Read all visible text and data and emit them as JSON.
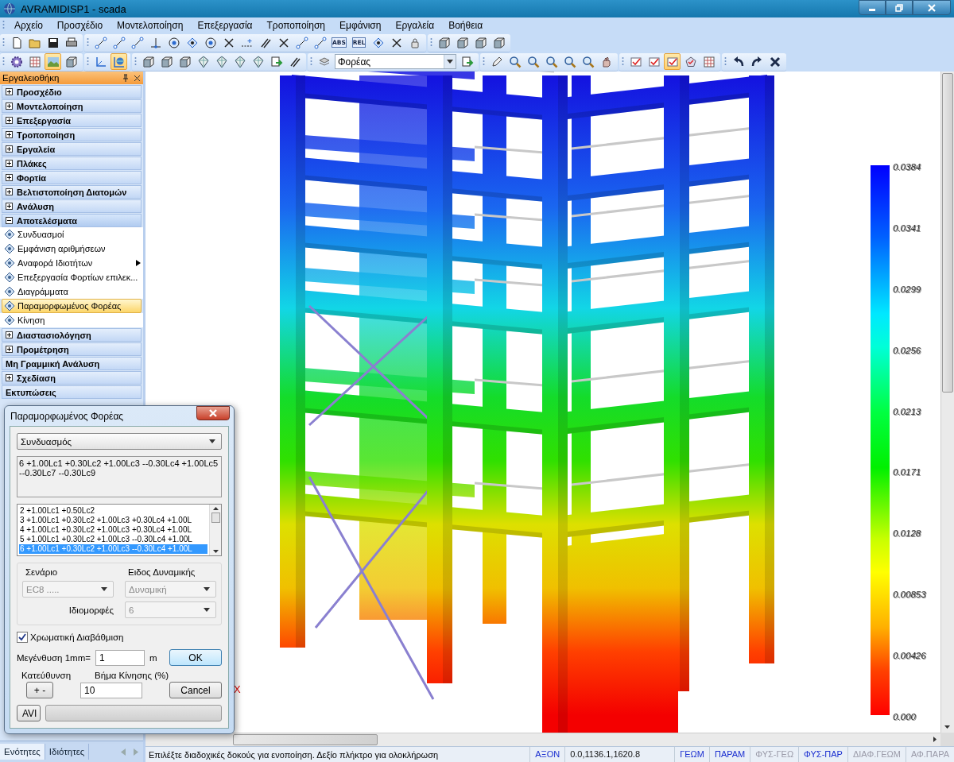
{
  "window": {
    "title": "AVRAMIDISP1 - scada"
  },
  "menu": [
    "Αρχείο",
    "Προσχέδιο",
    "Μοντελοποίηση",
    "Επεξεργασία",
    "Τροποποίηση",
    "Εμφάνιση",
    "Εργαλεία",
    "Βοήθεια"
  ],
  "toolbars": [
    {
      "groups": [
        {
          "items": [
            {
              "kind": "doc",
              "selected": false
            },
            {
              "kind": "folder",
              "selected": false
            },
            {
              "kind": "save",
              "selected": false
            },
            {
              "kind": "print",
              "selected": false
            }
          ]
        },
        {
          "items": [
            {
              "kind": "line",
              "selected": false
            },
            {
              "kind": "line",
              "selected": false
            },
            {
              "kind": "line",
              "selected": false
            },
            {
              "kind": "perp",
              "selected": false
            },
            {
              "kind": "circle",
              "selected": false
            },
            {
              "kind": "node",
              "selected": false
            },
            {
              "kind": "circle",
              "selected": false
            },
            {
              "kind": "cross",
              "selected": false
            },
            {
              "kind": "dash",
              "selected": false
            },
            {
              "kind": "parallel",
              "selected": false
            },
            {
              "kind": "cross",
              "selected": false
            },
            {
              "kind": "line",
              "selected": false
            },
            {
              "kind": "line",
              "selected": false
            },
            {
              "kind": "text",
              "label": "ABS",
              "selected": false
            },
            {
              "kind": "text",
              "label": "REL",
              "selected": false
            },
            {
              "kind": "node",
              "selected": false
            },
            {
              "kind": "cross",
              "selected": false
            },
            {
              "kind": "lock",
              "selected": false
            }
          ]
        },
        {
          "items": [
            {
              "kind": "cube",
              "selected": false
            },
            {
              "kind": "cube",
              "selected": false
            },
            {
              "kind": "cube",
              "selected": false
            },
            {
              "kind": "cube",
              "selected": false
            }
          ]
        }
      ]
    },
    {
      "groups": [
        {
          "items": [
            {
              "kind": "gear",
              "selected": false
            },
            {
              "kind": "grid",
              "selected": false
            },
            {
              "kind": "image",
              "selected": true
            },
            {
              "kind": "cube",
              "selected": false
            }
          ]
        },
        {
          "items": [
            {
              "kind": "axes",
              "selected": false
            },
            {
              "kind": "globe",
              "selected": true
            }
          ]
        },
        {
          "items": [
            {
              "kind": "cube",
              "selected": false
            },
            {
              "kind": "cube",
              "selected": false
            },
            {
              "kind": "cube",
              "selected": false
            },
            {
              "kind": "diamond",
              "selected": false
            },
            {
              "kind": "diamond",
              "selected": false
            },
            {
              "kind": "diamond",
              "selected": false
            },
            {
              "kind": "diamond",
              "selected": false
            },
            {
              "kind": "export",
              "selected": false
            },
            {
              "kind": "parallel",
              "selected": false
            }
          ]
        },
        {
          "items": [
            {
              "kind": "layers",
              "selected": false
            },
            {
              "kind": "combo",
              "value": "Φορέας"
            },
            {
              "kind": "export",
              "selected": false
            }
          ]
        },
        {
          "items": [
            {
              "kind": "pencil",
              "selected": false
            },
            {
              "kind": "zoom",
              "selected": false
            },
            {
              "kind": "zoom",
              "selected": false
            },
            {
              "kind": "zoom",
              "selected": false
            },
            {
              "kind": "zoom",
              "selected": false
            },
            {
              "kind": "zoom",
              "selected": false
            },
            {
              "kind": "hand",
              "selected": false
            }
          ]
        },
        {
          "items": [
            {
              "kind": "check",
              "selected": false
            },
            {
              "kind": "check",
              "selected": false
            },
            {
              "kind": "check",
              "selected": true
            },
            {
              "kind": "pentagon",
              "selected": false
            },
            {
              "kind": "grid",
              "selected": false
            }
          ]
        },
        {
          "items": [
            {
              "kind": "undo",
              "selected": false
            },
            {
              "kind": "redo",
              "selected": false
            },
            {
              "kind": "close",
              "selected": false
            }
          ]
        }
      ]
    }
  ],
  "toolbox": {
    "title": "Εργαλειοθήκη",
    "sections": [
      {
        "label": "Προσχέδιο",
        "expandable": true,
        "expanded": false
      },
      {
        "label": "Μοντελοποίηση",
        "expandable": true,
        "expanded": false
      },
      {
        "label": "Επεξεργασία",
        "expandable": true,
        "expanded": false
      },
      {
        "label": "Τροποποίηση",
        "expandable": true,
        "expanded": false
      },
      {
        "label": "Εργαλεία",
        "expandable": true,
        "expanded": false
      },
      {
        "label": "Πλάκες",
        "expandable": true,
        "expanded": false
      },
      {
        "label": "Φορτία",
        "expandable": true,
        "expanded": false
      },
      {
        "label": "Βελτιστοποίηση Διατομών",
        "expandable": true,
        "expanded": false
      },
      {
        "label": "Ανάλυση",
        "expandable": true,
        "expanded": false
      },
      {
        "label": "Αποτελέσματα",
        "expandable": true,
        "expanded": true,
        "children": [
          {
            "label": "Συνδυασμοί",
            "selected": false,
            "has_submenu": false
          },
          {
            "label": "Εμφάνιση αριθμήσεων",
            "selected": false,
            "has_submenu": false
          },
          {
            "label": "Αναφορά Ιδιοτήτων",
            "selected": false,
            "has_submenu": true
          },
          {
            "label": "Επεξεργασία Φορτίων επιλεκ...",
            "selected": false,
            "has_submenu": false
          },
          {
            "label": "Διαγράμματα",
            "selected": false,
            "has_submenu": false
          },
          {
            "label": "Παραμορφωμένος Φορέας",
            "selected": true,
            "has_submenu": false
          },
          {
            "label": "Κίνηση",
            "selected": false,
            "has_submenu": false
          }
        ]
      },
      {
        "label": "Διαστασιολόγηση",
        "expandable": true,
        "expanded": false
      },
      {
        "label": "Προμέτρηση",
        "expandable": true,
        "expanded": false
      },
      {
        "label": "Μη Γραμμική Ανάλυση",
        "expandable": false
      },
      {
        "label": "Σχεδίαση",
        "expandable": true,
        "expanded": false
      },
      {
        "label": "Εκτυπώσεις",
        "expandable": false
      }
    ]
  },
  "panel_tabs": [
    {
      "label": "Ενότητες",
      "selected": true
    },
    {
      "label": "Ιδιότητες",
      "selected": false
    }
  ],
  "viewport": {
    "axis_label": "X",
    "color_scale": {
      "labels": [
        "0.0384",
        "0.0341",
        "0.0299",
        "0.0256",
        "0.0213",
        "0.0171",
        "0.0128",
        "0.00853",
        "0.00426",
        "0.000"
      ]
    }
  },
  "dialog": {
    "title": "Παραμορφωμένος Φορέας",
    "type_select": {
      "value": "Συνδυασμός"
    },
    "combination_text": "6 +1.00Lc1 +0.30Lc2 +1.00Lc3 --0.30Lc4 +1.00Lc5 --0.30Lc7 --0.30Lc9",
    "combinations": [
      {
        "label": "2 +1.00Lc1 +0.50Lc2",
        "selected": false
      },
      {
        "label": "3 +1.00Lc1 +0.30Lc2 +1.00Lc3 +0.30Lc4 +1.00L",
        "selected": false
      },
      {
        "label": "4 +1.00Lc1 +0.30Lc2 +1.00Lc3 +0.30Lc4 +1.00L",
        "selected": false
      },
      {
        "label": "5 +1.00Lc1 +0.30Lc2 +1.00Lc3 --0.30Lc4 +1.00L",
        "selected": false
      },
      {
        "label": "6 +1.00Lc1 +0.30Lc2 +1.00Lc3 --0.30Lc4 +1.00L",
        "selected": true
      }
    ],
    "scenario": {
      "label": "Σενάριο",
      "value": "EC8 .....",
      "disabled": true
    },
    "dynamics_type": {
      "label": "Ειδος Δυναμικής",
      "value": "Δυναμική",
      "disabled": true
    },
    "modes": {
      "label": "Ιδιομορφές",
      "value": "6",
      "disabled": true
    },
    "color_gradation": {
      "label": "Χρωματική Διαβάθμιση",
      "checked": true
    },
    "magnification": {
      "label": "Μεγένθυση 1mm=",
      "value": "1",
      "unit": "m"
    },
    "direction": {
      "label": "Κατεύθυνση",
      "button": "+ -"
    },
    "step": {
      "label": "Βήμα Κίνησης (%)",
      "value": "10"
    },
    "ok": "OK",
    "cancel": "Cancel",
    "avi": "AVI",
    "progress": {
      "level": 0
    }
  },
  "status_bar": {
    "message": "Επιλέξτε διαδοχικές δοκούς για ενοποίηση. Δεξίο πλήκτρο για ολοκλήρωση",
    "fields": [
      {
        "kind": "mode",
        "label": "ΑΞΟΝ",
        "on": true
      },
      {
        "kind": "coords",
        "label": "0.0,1136.1,1620.8"
      },
      {
        "kind": "mode",
        "label": "ΓΕΩΜ",
        "on": true
      },
      {
        "kind": "mode",
        "label": "ΠΑΡΑΜ",
        "on": true
      },
      {
        "kind": "mode",
        "label": "ΦΥΣ-ΓΕΩ",
        "on": false
      },
      {
        "kind": "mode",
        "label": "ΦΥΣ-ΠΑΡ",
        "on": true
      },
      {
        "kind": "mode",
        "label": "ΔΙΑΦ.ΓΕΩΜ",
        "on": false
      },
      {
        "kind": "mode",
        "label": "ΑΦ.ΠΑΡΑ",
        "on": false
      }
    ]
  }
}
